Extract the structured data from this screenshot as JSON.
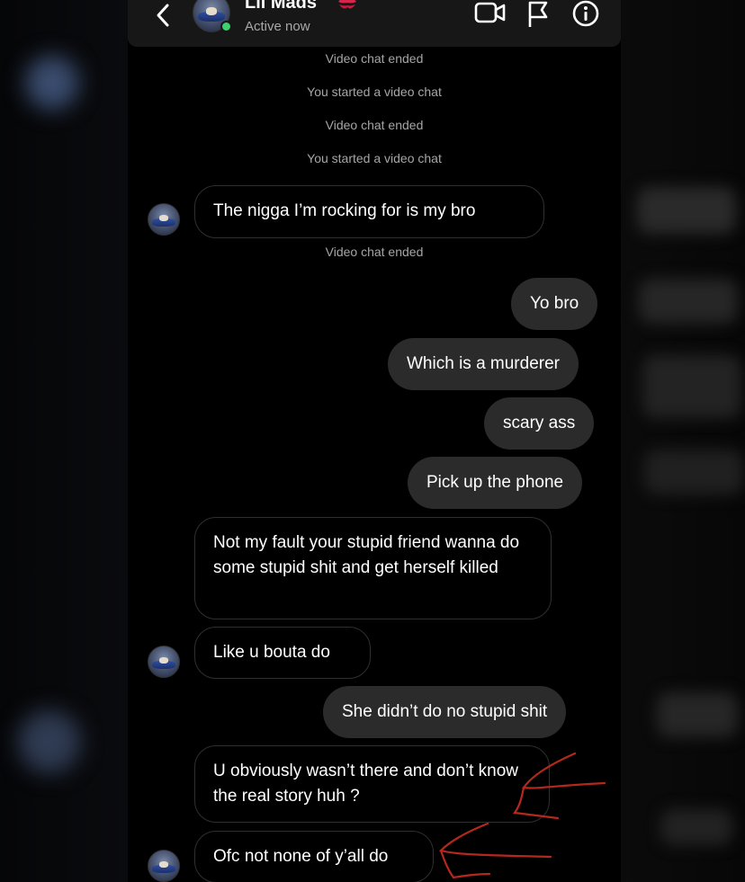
{
  "header": {
    "contact_name": "Lil Mads",
    "status": "Active now",
    "icons": [
      "back-icon",
      "video-call-icon",
      "flag-icon",
      "info-icon"
    ]
  },
  "thread": {
    "system": [
      "Video chat ended",
      "You started a video chat",
      "Video chat ended",
      "You started a video chat",
      "Video chat ended"
    ],
    "messages": [
      "The nigga I’m rocking for is my bro",
      "Yo bro",
      "Which is a murderer",
      "scary ass",
      "Pick up the phone",
      "Not my fault your stupid friend wanna do some stupid shit and get herself killed",
      "Like u bouta do",
      "She didn’t do no stupid shit",
      "U obviously wasn’t there and don’t know the real story huh ?",
      "Ofc not none of y’all do"
    ]
  },
  "colors": {
    "background": "#000000",
    "header": "#171717",
    "outgoing_bubble": "#2b2b2b",
    "incoming_border": "#2f2f2f",
    "online": "#3bd16f",
    "annotation": "#b4281e"
  }
}
